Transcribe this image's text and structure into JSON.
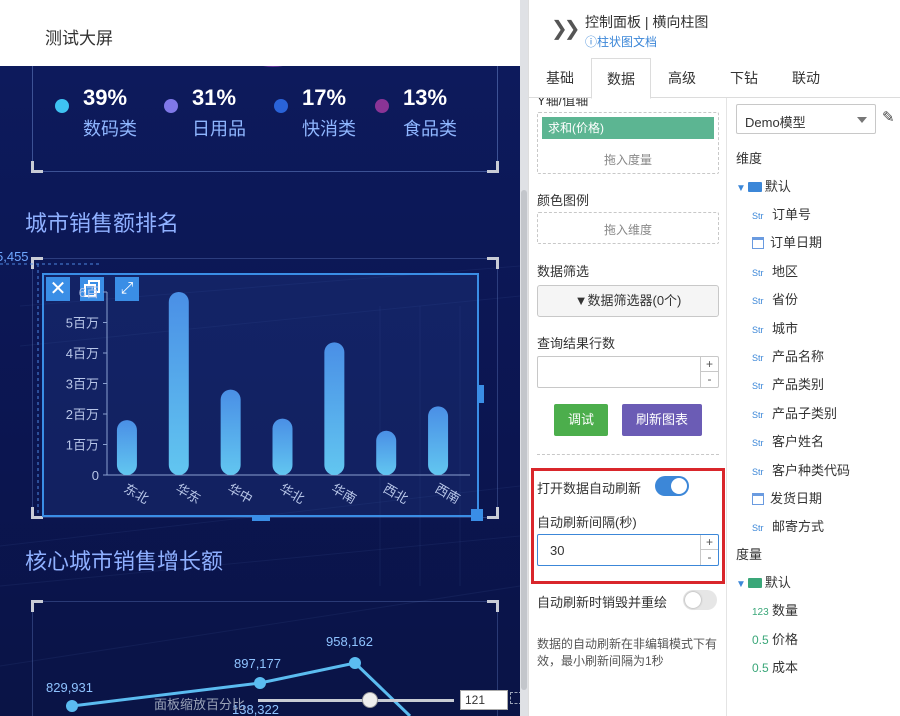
{
  "canvas": {
    "page_title": "测试大屏",
    "legend": [
      {
        "pct": "39%",
        "name": "数码类",
        "color": "#3ec2f2"
      },
      {
        "pct": "31%",
        "name": "日用品",
        "color": "#7f78e8"
      },
      {
        "pct": "17%",
        "name": "快消类",
        "color": "#2a63d8"
      },
      {
        "pct": "13%",
        "name": "食品类",
        "color": "#8a3496"
      }
    ],
    "section1_title": "城市销售额排名",
    "section2_title": "核心城市销售增长额",
    "partial_value": "5,455",
    "zoom_label": "面板缩放百分比",
    "zoom_value": "121",
    "line_labels": [
      "829,931",
      "897,177",
      "958,162",
      "138,322"
    ]
  },
  "chart_data": {
    "type": "bar",
    "categories": [
      "东北",
      "华东",
      "华中",
      "华北",
      "华南",
      "西北",
      "西南"
    ],
    "values": [
      1800000,
      6000000,
      2800000,
      1850000,
      4350000,
      1450000,
      2250000
    ],
    "ylim": [
      0,
      6000000
    ],
    "yticks": [
      0,
      1000000,
      2000000,
      3000000,
      4000000,
      5000000
    ],
    "ytick_labels": [
      "0",
      "1百万",
      "2百万",
      "3百万",
      "4百万",
      "5百万",
      "6百"
    ],
    "bar_gradient": [
      "#4a8fe6",
      "#62c6f0"
    ]
  },
  "panel": {
    "title": "控制面板 | 横向柱图",
    "doc_link": "柱状图文档",
    "tabs": [
      "基础",
      "数据",
      "高级",
      "下钻",
      "联动"
    ],
    "active_tab": "数据",
    "y_axis_label": "Y轴/值轴",
    "y_field": "求和(价格)",
    "drop_measure_hint": "拖入度量",
    "color_legend_label": "颜色图例",
    "drop_dimension_hint": "拖入维度",
    "filter_label": "数据筛选",
    "filter_button": "数据筛选器(0个)",
    "rows_label": "查询结果行数",
    "rows_value": "",
    "debug_button": "调试",
    "refresh_button": "刷新图表",
    "auto_refresh_label": "打开数据自动刷新",
    "auto_refresh_on": true,
    "interval_label": "自动刷新间隔(秒)",
    "interval_value": "30",
    "destroy_label": "自动刷新时销毁并重绘",
    "destroy_on": false,
    "note": "数据的自动刷新在非编辑模式下有效，最小刷新间隔为1秒",
    "model_select": "Demo模型",
    "dimension_title": "维度",
    "measure_title": "度量",
    "default_folder": "默认",
    "dimensions": [
      {
        "type": "Str",
        "name": "订单号"
      },
      {
        "type": "date",
        "name": "订单日期"
      },
      {
        "type": "Str",
        "name": "地区"
      },
      {
        "type": "Str",
        "name": "省份"
      },
      {
        "type": "Str",
        "name": "城市"
      },
      {
        "type": "Str",
        "name": "产品名称"
      },
      {
        "type": "Str",
        "name": "产品类别"
      },
      {
        "type": "Str",
        "name": "产品子类别"
      },
      {
        "type": "Str",
        "name": "客户姓名"
      },
      {
        "type": "Str",
        "name": "客户种类代码"
      },
      {
        "type": "date",
        "name": "发货日期"
      },
      {
        "type": "Str",
        "name": "邮寄方式"
      }
    ],
    "measures": [
      {
        "type": "123",
        "name": "数量"
      },
      {
        "type": "0.5",
        "name": "价格"
      },
      {
        "type": "0.5",
        "name": "成本"
      }
    ],
    "colors": {
      "accent": "#3c87d8",
      "green": "#4cae4c",
      "purple": "#6b5cb5",
      "highlight": "#d9262b"
    }
  }
}
